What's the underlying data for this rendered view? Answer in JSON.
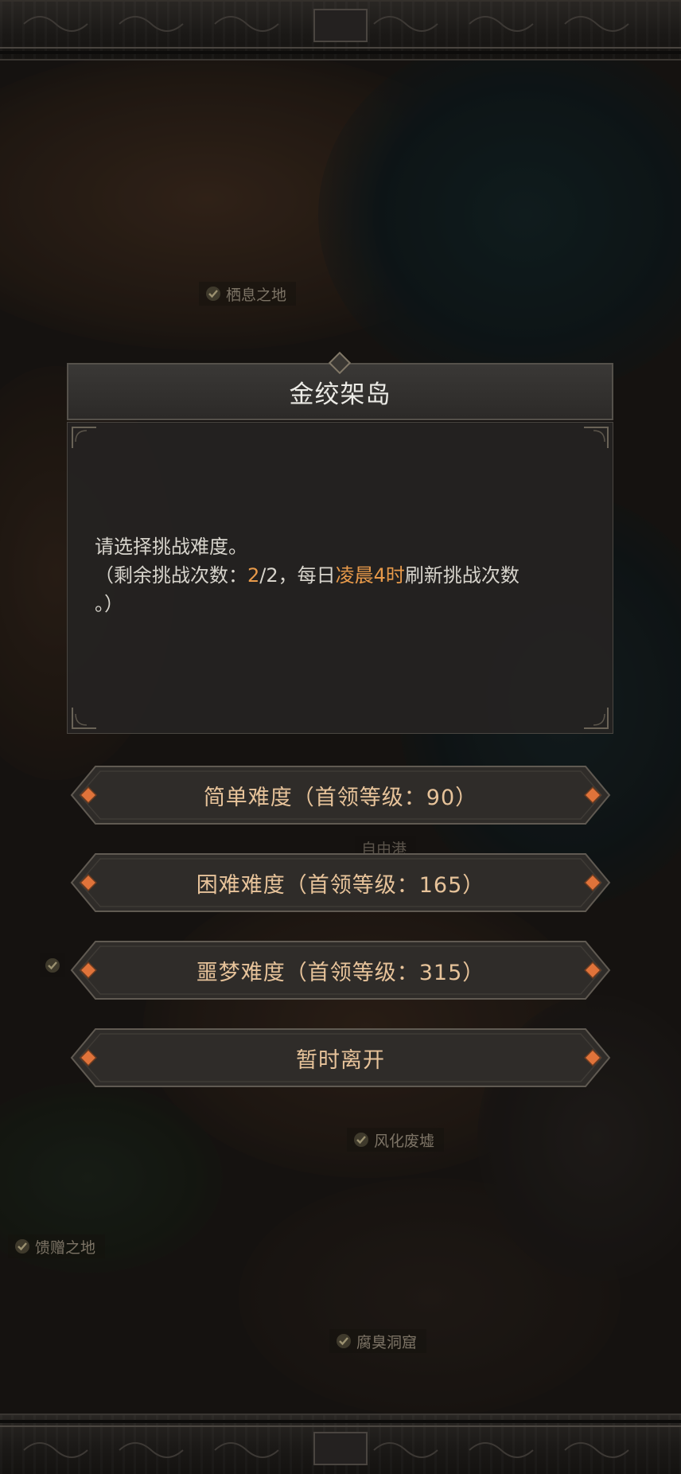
{
  "map": {
    "locations": [
      {
        "name": "栖息之地"
      },
      {
        "name": "自由港"
      },
      {
        "name": "风化废墟"
      },
      {
        "name": "馈赠之地"
      },
      {
        "name": "腐臭洞窟"
      }
    ]
  },
  "dialog": {
    "title": "金绞架岛",
    "line1": "请选择挑战难度。",
    "line2_prefix": "（剩余挑战次数：",
    "remaining": "2",
    "line2_sep": "/2，每日",
    "refresh_time": "凌晨4时",
    "line2_suffix": "刷新挑战次数",
    "line3": "。）"
  },
  "options": [
    {
      "label": "简单难度（首领等级：90）"
    },
    {
      "label": "困难难度（首领等级：165）"
    },
    {
      "label": "噩梦难度（首领等级：315）"
    },
    {
      "label": "暂时离开"
    }
  ],
  "colors": {
    "highlight": "#e89a4a",
    "button_text": "#e7c39a",
    "gem": "#e0733a"
  }
}
